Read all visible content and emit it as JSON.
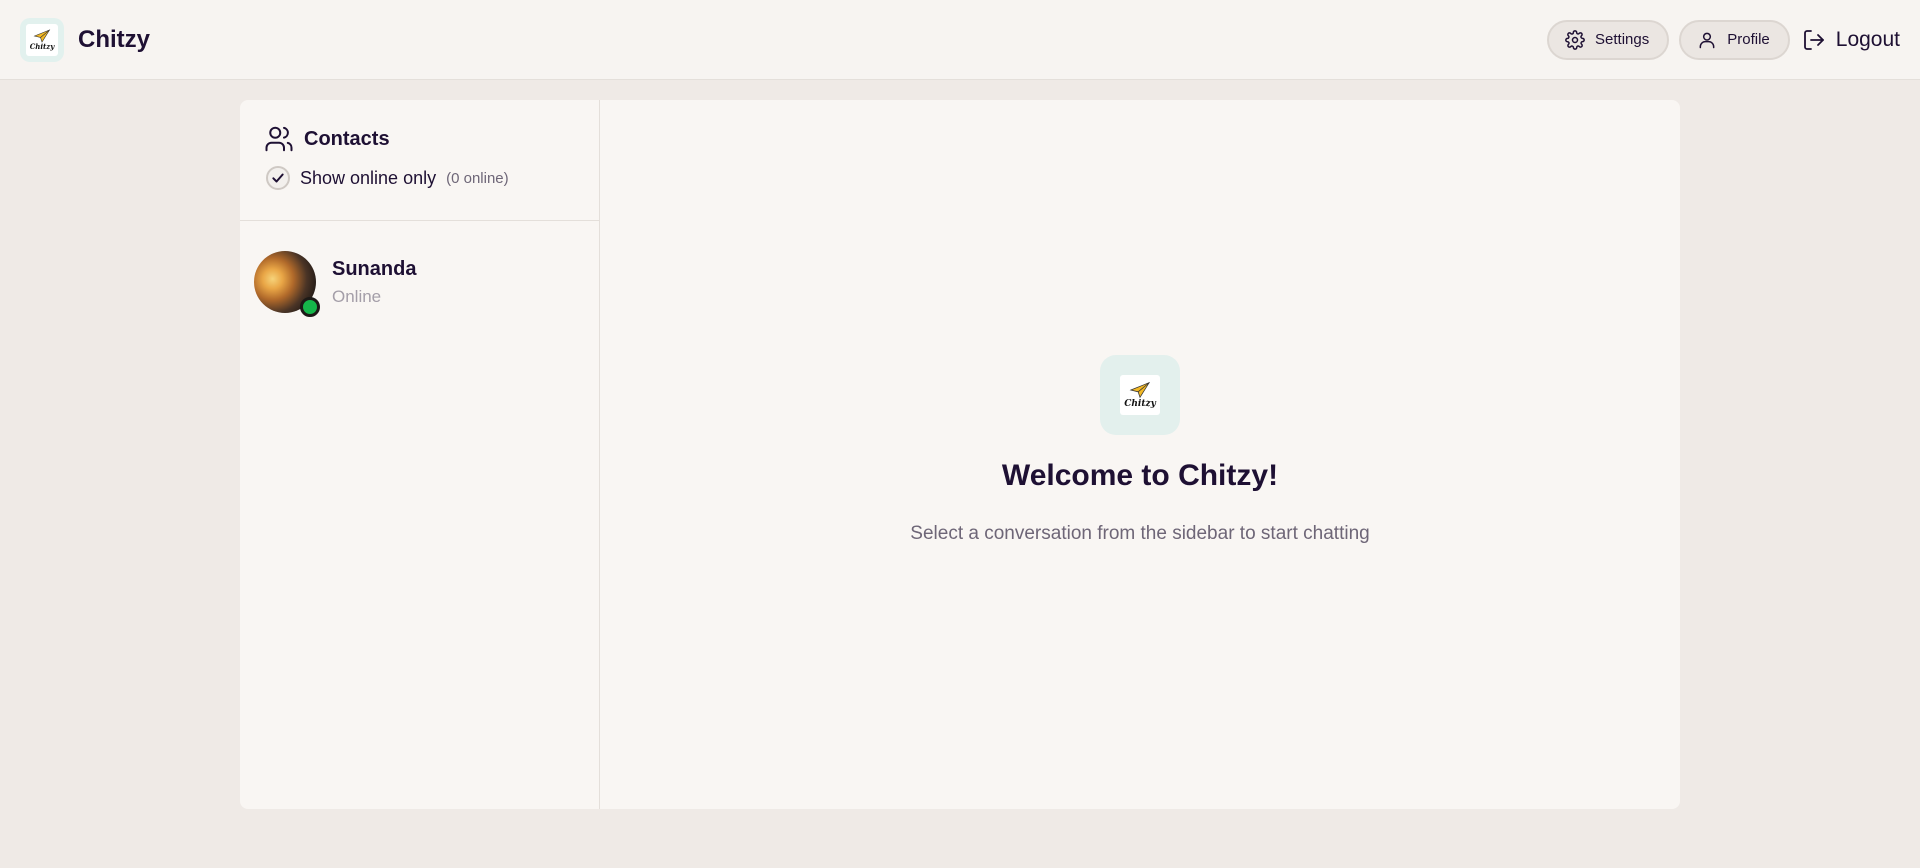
{
  "header": {
    "brand_name": "Chitzy",
    "logo_text": "Chitzy",
    "settings_label": "Settings",
    "profile_label": "Profile",
    "logout_label": "Logout"
  },
  "sidebar": {
    "title": "Contacts",
    "filter_label": "Show online only",
    "filter_checked": true,
    "online_count": "(0 online)",
    "contacts": [
      {
        "name": "Sunanda",
        "status": "Online",
        "status_color": "#15b64a"
      }
    ]
  },
  "welcome": {
    "title": "Welcome to Chitzy!",
    "subtitle": "Select a conversation from the sidebar to start chatting"
  },
  "colors": {
    "background": "#efeae6",
    "panel": "#f9f6f3",
    "text_primary": "#1e1033",
    "text_muted": "#6e6677",
    "logo_bg": "#e2f1ee"
  },
  "icons": {
    "settings": "gear-icon",
    "profile": "user-icon",
    "logout": "logout-icon",
    "contacts": "users-icon",
    "checkbox": "check-icon"
  }
}
